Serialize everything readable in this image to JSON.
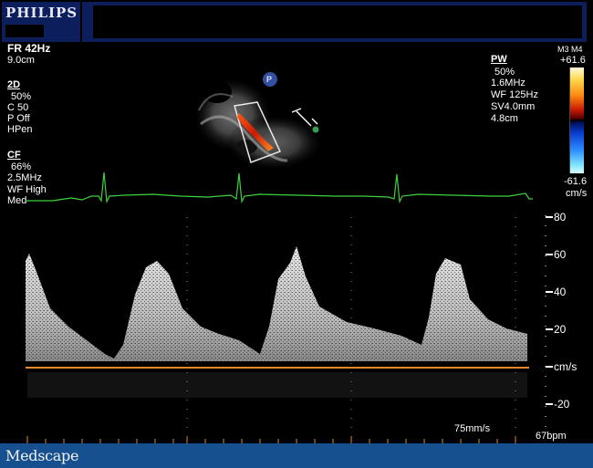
{
  "header": {
    "brand": "PHILIPS"
  },
  "left_params": {
    "frame_rate": "FR 42Hz",
    "depth": "9.0cm",
    "mode_2d_title": "2D",
    "mode_2d_lines": [
      "50%",
      "C 50",
      "P Off",
      "HPen"
    ],
    "cf_title": "CF",
    "cf_lines": [
      "66%",
      "2.5MHz",
      "WF High",
      "Med"
    ]
  },
  "pw_params": {
    "title": "PW",
    "lines": [
      "50%",
      "1.6MHz",
      "WF 125Hz",
      "SV4.0mm",
      "4.8cm"
    ]
  },
  "color_scale": {
    "modes": "M3 M4",
    "max": "+61.6",
    "min": "-61.6",
    "unit": "cm/s"
  },
  "probe_marker": "P",
  "spectral_axis": {
    "labels": [
      "80",
      "60",
      "40",
      "20",
      "cm/s",
      "-20"
    ]
  },
  "sweep_speed": "75mm/s",
  "heart_rate": "67bpm",
  "footer": {
    "logo": "Medscape"
  }
}
